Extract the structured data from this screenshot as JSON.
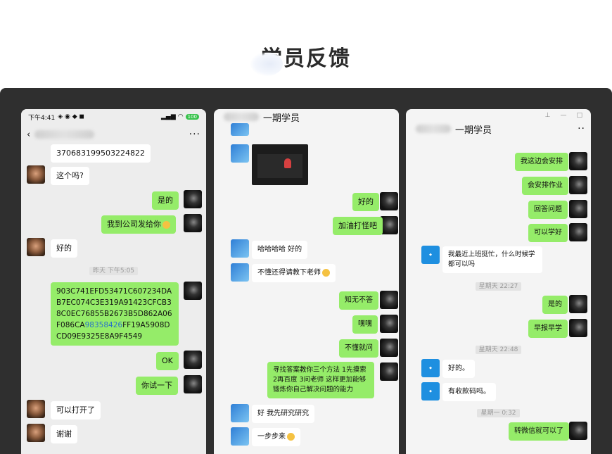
{
  "page": {
    "title": "学员反馈"
  },
  "shot1": {
    "status": {
      "time": "下午4:41",
      "battery": "100"
    },
    "header": {
      "more": "···"
    },
    "messages": [
      {
        "text": "370683199503224822"
      },
      {
        "text": "这个吗?"
      },
      {
        "text": "是的"
      },
      {
        "text": "我到公司发给你"
      },
      {
        "text": "好的"
      },
      {
        "text": "昨天 下午5:05"
      },
      {
        "text_a": "903C741EFD53471C607234DAB7EC074C3E319A91423CFCB38C0EC76855B2673B5D862A06F086CA",
        "text_b": "98358426",
        "text_c": "FF19A5908DCD09E9325E8A9F4549"
      },
      {
        "text": "OK"
      },
      {
        "text": "你试一下"
      },
      {
        "text": "可以打开了"
      },
      {
        "text": "谢谢"
      }
    ]
  },
  "shot2": {
    "header": {
      "title": "一期学员"
    },
    "messages": [
      {
        "text": "好的"
      },
      {
        "text": "加油打怪吧"
      },
      {
        "text": "哈哈哈哈 好的"
      },
      {
        "text": "不懂还得请教下老师"
      },
      {
        "text": "知无不答"
      },
      {
        "text": "嘿嘿"
      },
      {
        "text": "不懂就问"
      },
      {
        "text": "寻找答案教你三个方法 1先摸索 2再百度 3问老师 这样更加能够锻炼你自己解决问题的能力"
      },
      {
        "text": "好 我先研究研究"
      },
      {
        "text": "一步步来"
      }
    ]
  },
  "shot3": {
    "header": {
      "title": "一期学员",
      "more": "··"
    },
    "messages": [
      {
        "text": "我这边会安排"
      },
      {
        "text": "会安排作业"
      },
      {
        "text": "回答问题"
      },
      {
        "text": "可以学好"
      },
      {
        "text": "我最近上班挺忙，什么时候学都可以吗"
      },
      {
        "text": "星期天 22:27"
      },
      {
        "text": "是的"
      },
      {
        "text": "早报早学"
      },
      {
        "text": "星期天 22:48"
      },
      {
        "text": "好的。"
      },
      {
        "text": "有收款码吗。"
      },
      {
        "text": "星期一 0:32"
      },
      {
        "text": "转微信就可以了"
      }
    ]
  }
}
